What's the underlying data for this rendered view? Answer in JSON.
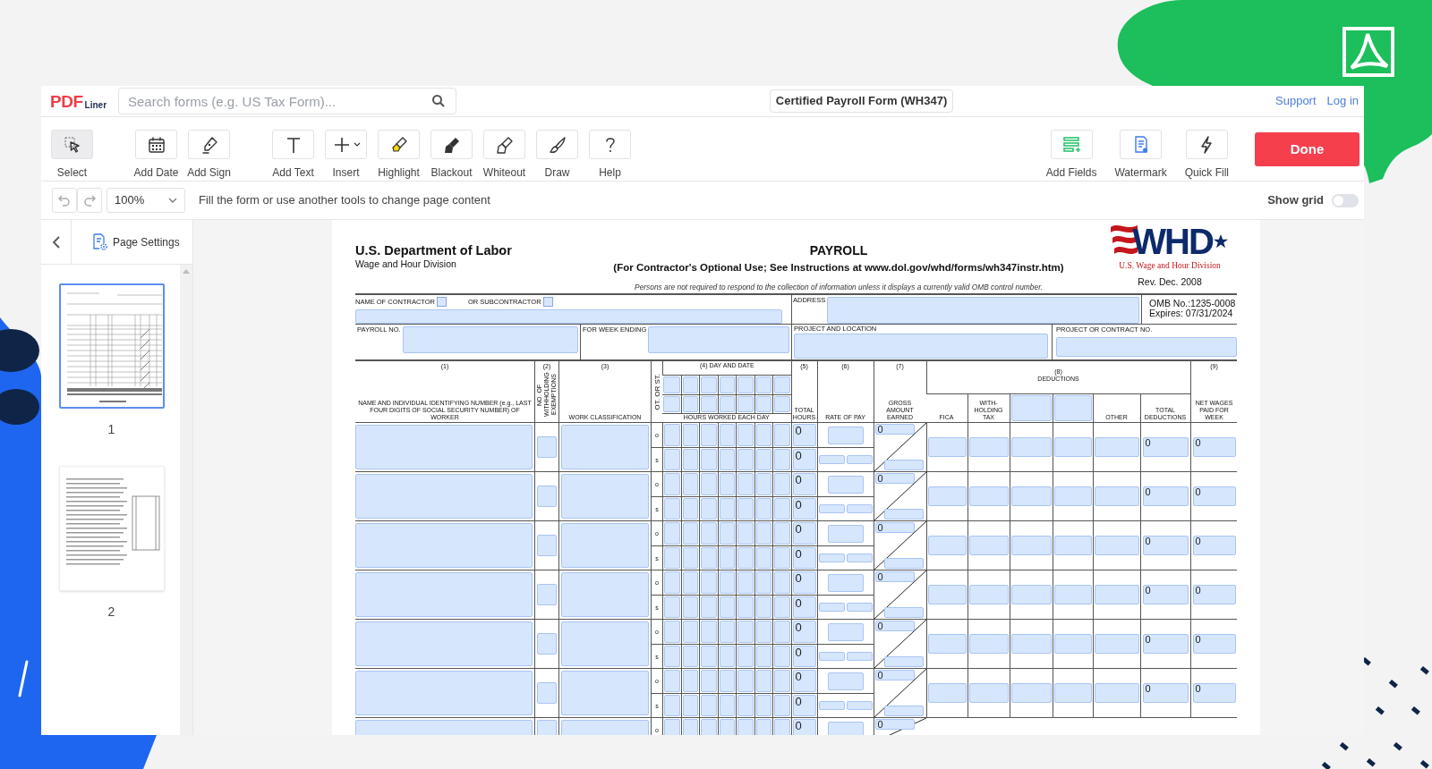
{
  "app": {
    "logo": {
      "main": "PDF",
      "sub": "Liner"
    },
    "search": {
      "placeholder": "Search forms (e.g. US Tax Form)..."
    },
    "document_title": "Certified Payroll Form (WH347)",
    "links": [
      "Support",
      "Log in"
    ]
  },
  "toolbar": {
    "tool_groups": [
      {
        "tools": [
          {
            "label": "Select",
            "selected": true,
            "has_menu": false
          }
        ]
      },
      {
        "tools": [
          {
            "label": "Add Date",
            "selected": false,
            "has_menu": false
          },
          {
            "label": "Add Sign",
            "selected": false,
            "has_menu": false
          }
        ]
      },
      {
        "tools": [
          {
            "label": "Add Text",
            "selected": false,
            "has_menu": false
          },
          {
            "label": "Insert",
            "selected": false,
            "has_menu": true
          },
          {
            "label": "Highlight",
            "selected": false,
            "has_menu": false
          },
          {
            "label": "Blackout",
            "selected": false,
            "has_menu": false
          },
          {
            "label": "Whiteout",
            "selected": false,
            "has_menu": false
          },
          {
            "label": "Draw",
            "selected": false,
            "has_menu": false
          },
          {
            "label": "Help",
            "selected": false,
            "has_menu": false
          }
        ]
      }
    ],
    "right_tools": [
      {
        "label": "Add Fields"
      },
      {
        "label": "Watermark"
      },
      {
        "label": "Quick Fill"
      }
    ],
    "done": "Done"
  },
  "subbar": {
    "zoom": "100%",
    "hint": "Fill the form or use another tools to change page content",
    "show_grid": {
      "label": "Show grid",
      "on": false
    }
  },
  "sidebar": {
    "title": "Page Settings",
    "pages": [
      {
        "number": "1",
        "selected": true,
        "kind": "table"
      },
      {
        "number": "2",
        "selected": false,
        "kind": "text"
      }
    ]
  },
  "form": {
    "agency": "U.S. Department of Labor",
    "division": "Wage and Hour Division",
    "title": "PAYROLL",
    "subtitle": "(For Contractor's Optional Use; See Instructions at www.dol.gov/whd/forms/wh347instr.htm)",
    "notice": "Persons are not required to respond to the collection of information unless it displays a currently valid OMB control number.",
    "logo": {
      "text": "WHD",
      "caption": "U.S. Wage and Hour Division"
    },
    "revision": "Rev. Dec. 2008",
    "omb": [
      "OMB No.:1235-0008",
      "Expires: 07/31/2024"
    ],
    "contractor": {
      "label": "NAME OF CONTRACTOR",
      "checked": false
    },
    "subcontractor": {
      "label": "OR SUBCONTRACTOR",
      "checked": false
    },
    "address_label": "ADDRESS",
    "payroll_no_label": "PAYROLL NO.",
    "week_ending_label": "FOR WEEK ENDING",
    "project_location_label": "PROJECT AND LOCATION",
    "contract_no_label": "PROJECT OR CONTRACT NO.",
    "columns": {
      "worker": {
        "number": "(1)",
        "label": "NAME AND INDIVIDUAL IDENTIFYING NUMBER (e.g., LAST FOUR DIGITS OF SOCIAL SECURITY NUMBER) OF WORKER"
      },
      "exemptions": {
        "number": "(2)",
        "label": "NO. OF WITHHOLDING EXEMPTIONS"
      },
      "classification": {
        "number": "(3)",
        "label": "WORK CLASSIFICATION"
      },
      "ot_st": "OT. OR ST.",
      "days": {
        "title": "(4) DAY AND DATE",
        "subtitle": "HOURS WORKED EACH DAY"
      },
      "total_hours": {
        "number": "(5)",
        "label": "TOTAL HOURS"
      },
      "rate": {
        "number": "(6)",
        "label": "RATE OF PAY"
      },
      "gross": {
        "number": "(7)",
        "label": "GROSS AMOUNT EARNED"
      },
      "deductions": {
        "number": "(8)",
        "label": "DEDUCTIONS",
        "parts": [
          {
            "kind": "label",
            "label": "FICA"
          },
          {
            "kind": "label",
            "label": "WITH- HOLDING TAX"
          },
          {
            "kind": "field"
          },
          {
            "kind": "field"
          },
          {
            "kind": "label",
            "label": "OTHER"
          },
          {
            "kind": "label",
            "label": "TOTAL DEDUCTIONS"
          }
        ]
      },
      "net": {
        "number": "(9)",
        "label": "NET WAGES PAID FOR WEEK"
      }
    },
    "rows": [
      {
        "lines": [
          {
            "label": "o",
            "total_hours": "0"
          },
          {
            "label": "s",
            "total_hours": "0"
          }
        ],
        "gross": "0",
        "total_deductions": "0",
        "net_wages": "0"
      },
      {
        "lines": [
          {
            "label": "o",
            "total_hours": "0"
          },
          {
            "label": "s",
            "total_hours": "0"
          }
        ],
        "gross": "0",
        "total_deductions": "0",
        "net_wages": "0"
      },
      {
        "lines": [
          {
            "label": "o",
            "total_hours": "0"
          },
          {
            "label": "s",
            "total_hours": "0"
          }
        ],
        "gross": "0",
        "total_deductions": "0",
        "net_wages": "0"
      },
      {
        "lines": [
          {
            "label": "o",
            "total_hours": "0"
          },
          {
            "label": "s",
            "total_hours": "0"
          }
        ],
        "gross": "0",
        "total_deductions": "0",
        "net_wages": "0"
      },
      {
        "lines": [
          {
            "label": "o",
            "total_hours": "0"
          },
          {
            "label": "s",
            "total_hours": "0"
          }
        ],
        "gross": "0",
        "total_deductions": "0",
        "net_wages": "0"
      },
      {
        "lines": [
          {
            "label": "o",
            "total_hours": "0"
          },
          {
            "label": "s",
            "total_hours": "0"
          }
        ],
        "gross": "0",
        "total_deductions": "0",
        "net_wages": "0"
      },
      {
        "lines": [
          {
            "label": "o",
            "total_hours": "0"
          }
        ],
        "gross": "0"
      }
    ]
  }
}
